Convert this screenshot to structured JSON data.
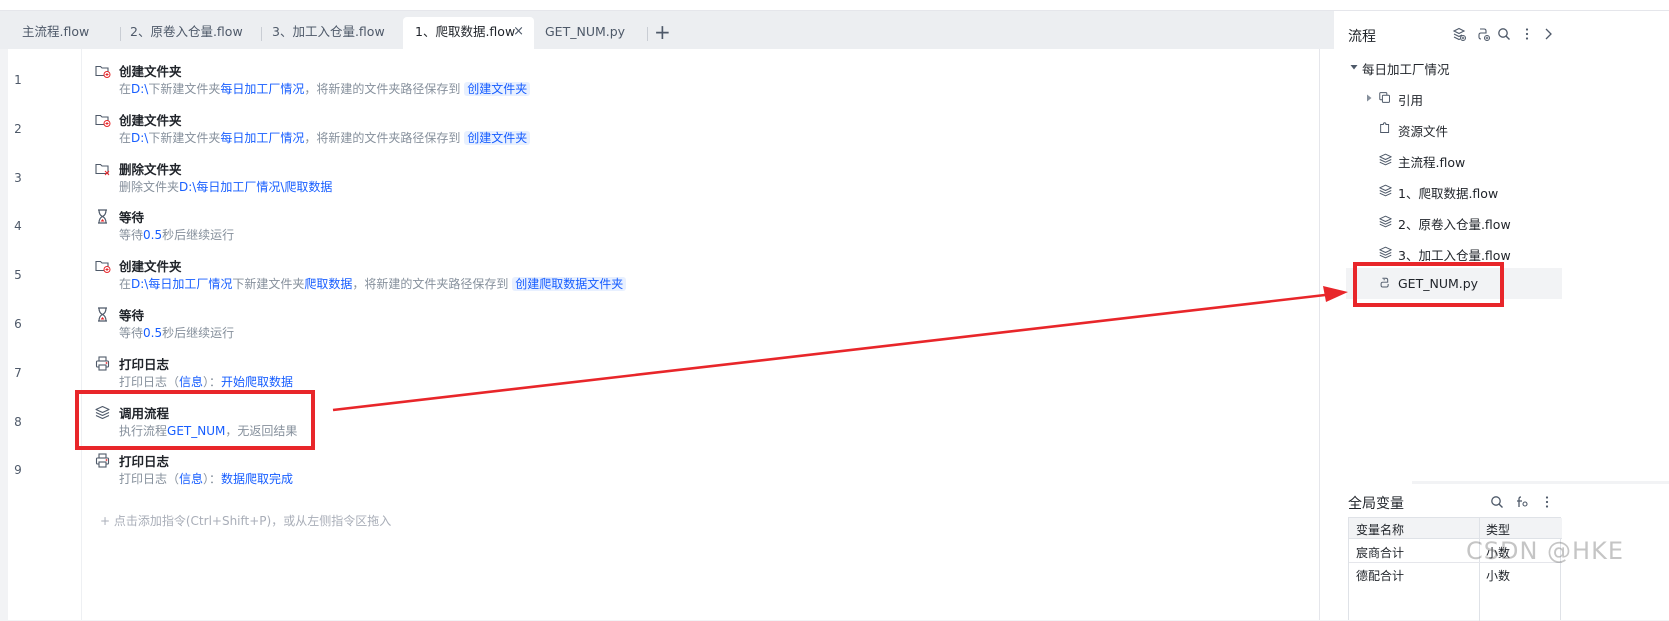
{
  "tabs": [
    {
      "label": "主流程.flow",
      "active": false
    },
    {
      "label": "2、原卷入仓量.flow",
      "active": false
    },
    {
      "label": "3、加工入仓量.flow",
      "active": false
    },
    {
      "label": "1、爬取数据.flow",
      "active": true
    },
    {
      "label": "GET_NUM.py",
      "active": false
    }
  ],
  "tab_close_glyph": "×",
  "add_tab_glyph": "+",
  "steps": [
    {
      "num": "1",
      "icon": "create-folder-icon",
      "title": "创建文件夹",
      "desc": [
        {
          "t": "在"
        },
        {
          "t": "D:\\",
          "hl": true
        },
        {
          "t": "下新建文件夹"
        },
        {
          "t": "每日加工厂情况",
          "hl": true
        },
        {
          "t": "，将新建的文件夹路径保存到 "
        },
        {
          "t": "创建文件夹",
          "chip": true
        }
      ]
    },
    {
      "num": "2",
      "icon": "create-folder-icon",
      "title": "创建文件夹",
      "desc": [
        {
          "t": "在"
        },
        {
          "t": "D:\\",
          "hl": true
        },
        {
          "t": "下新建文件夹"
        },
        {
          "t": "每日加工厂情况",
          "hl": true
        },
        {
          "t": "，将新建的文件夹路径保存到 "
        },
        {
          "t": "创建文件夹",
          "chip": true
        }
      ]
    },
    {
      "num": "3",
      "icon": "delete-folder-icon",
      "title": "删除文件夹",
      "desc": [
        {
          "t": "删除文件夹"
        },
        {
          "t": "D:\\每日加工厂情况\\爬取数据",
          "hl": true
        }
      ]
    },
    {
      "num": "4",
      "icon": "hourglass-icon",
      "title": "等待",
      "desc": [
        {
          "t": "等待"
        },
        {
          "t": "0.5",
          "hl": true
        },
        {
          "t": "秒后继续运行"
        }
      ]
    },
    {
      "num": "5",
      "icon": "create-folder-icon",
      "title": "创建文件夹",
      "desc": [
        {
          "t": "在"
        },
        {
          "t": "D:\\每日加工厂情况",
          "hl": true
        },
        {
          "t": "下新建文件夹"
        },
        {
          "t": "爬取数据",
          "hl": true
        },
        {
          "t": "，将新建的文件夹路径保存到 "
        },
        {
          "t": "创建爬取数据文件夹",
          "chip": true
        }
      ]
    },
    {
      "num": "6",
      "icon": "hourglass-icon",
      "title": "等待",
      "desc": [
        {
          "t": "等待"
        },
        {
          "t": "0.5",
          "hl": true
        },
        {
          "t": "秒后继续运行"
        }
      ]
    },
    {
      "num": "7",
      "icon": "printer-icon",
      "title": "打印日志",
      "desc": [
        {
          "t": "打印日志（"
        },
        {
          "t": "信息",
          "hl": true
        },
        {
          "t": "）："
        },
        {
          "t": "开始爬取数据",
          "hl": true
        }
      ]
    },
    {
      "num": "8",
      "icon": "layers-icon",
      "title": "调用流程",
      "desc": [
        {
          "t": "执行流程"
        },
        {
          "t": "GET_NUM",
          "hl": true
        },
        {
          "t": "，无返回结果"
        }
      ]
    },
    {
      "num": "9",
      "icon": "printer-icon",
      "title": "打印日志",
      "desc": [
        {
          "t": "打印日志（"
        },
        {
          "t": "信息",
          "hl": true
        },
        {
          "t": "）："
        },
        {
          "t": "数据爬取完成",
          "hl": true
        }
      ]
    }
  ],
  "add_instruction": "+ 点击添加指令(Ctrl+Shift+P)，或从左侧指令区拖入",
  "flow_panel": {
    "title": "流程",
    "root": "每日加工厂情况",
    "items": [
      {
        "label": "引用",
        "icon": "reference-icon"
      },
      {
        "label": "资源文件",
        "icon": "resource-file-icon"
      },
      {
        "label": "主流程.flow",
        "icon": "layers-icon"
      },
      {
        "label": "1、爬取数据.flow",
        "icon": "layers-icon"
      },
      {
        "label": "2、原卷入仓量.flow",
        "icon": "layers-icon"
      },
      {
        "label": "3、加工入仓量.flow",
        "icon": "layers-icon"
      },
      {
        "label": "GET_NUM.py",
        "icon": "python-icon"
      }
    ]
  },
  "globals_panel": {
    "title": "全局变量",
    "columns": [
      "变量名称",
      "类型"
    ],
    "rows": [
      {
        "name": "宸商合计",
        "type": "小数"
      },
      {
        "name": "德配合计",
        "type": "小数"
      }
    ]
  },
  "watermark": "CSDN @HKE",
  "colors": {
    "accent": "#165dff",
    "highlight_box": "#e8262a",
    "chip_bg": "#e8f0ff"
  }
}
